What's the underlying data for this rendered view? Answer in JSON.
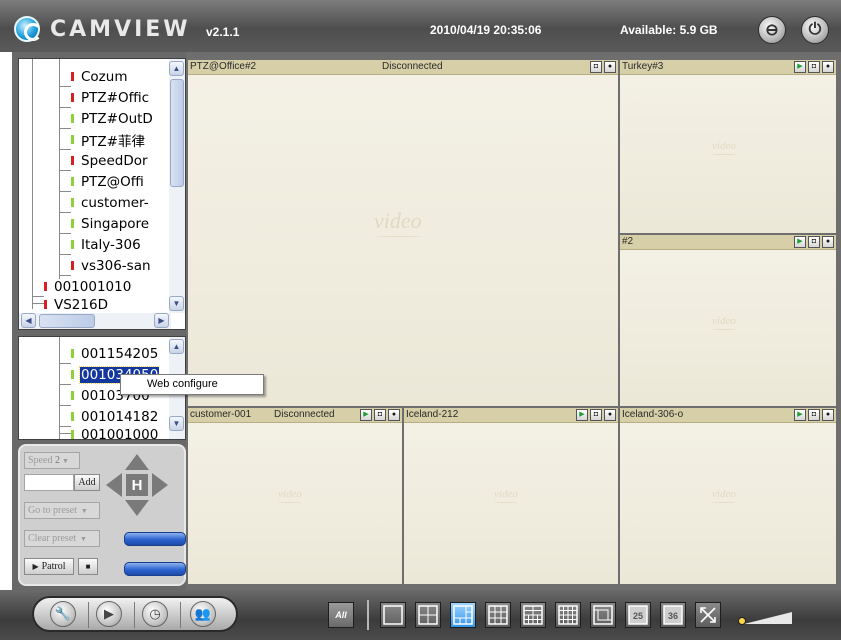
{
  "app": {
    "logo_text": "CAMVIEW",
    "version": "v2.1.1",
    "datetime": "2010/04/19 20:35:06",
    "available": "Available: 5.9 GB"
  },
  "colors": {
    "selection": "#14379e",
    "status_red": "#d72020",
    "status_green": "#8ed23a",
    "video_header": "#d7cfa8",
    "video_bg": "#f0ece0",
    "active_layout": "#3393e8"
  },
  "tree1": {
    "items": [
      {
        "label": "Cozum",
        "status": "red"
      },
      {
        "label": "PTZ#Offic",
        "status": "red"
      },
      {
        "label": "PTZ#OutD",
        "status": "green"
      },
      {
        "label": "PTZ#菲律",
        "status": "green"
      },
      {
        "label": "SpeedDor",
        "status": "red"
      },
      {
        "label": "PTZ@Offi",
        "status": "green"
      },
      {
        "label": "customer-",
        "status": "green"
      },
      {
        "label": "Singapore",
        "status": "green"
      },
      {
        "label": "Italy-306",
        "status": "green"
      },
      {
        "label": "vs306-san",
        "status": "red"
      },
      {
        "label": "001001010",
        "status": "red"
      },
      {
        "label": "VS216D",
        "status": "red"
      }
    ]
  },
  "tree2": {
    "items": [
      {
        "label": "001154205",
        "status": "green"
      },
      {
        "label": "001034050",
        "status": "green",
        "selected": true
      },
      {
        "label": "00103700",
        "status": "green"
      },
      {
        "label": "001014182",
        "status": "green"
      },
      {
        "label": "001001000",
        "status": "green"
      }
    ]
  },
  "context_menu": {
    "items": [
      "Web configure"
    ]
  },
  "ptz": {
    "speed_label": "Speed",
    "speed_value": "2",
    "add_label": "Add",
    "goto_preset": "Go to preset",
    "clear_preset": "Clear preset",
    "patrol_label": "Patrol",
    "home_label": "H"
  },
  "video": {
    "watermark": "video",
    "cells": [
      {
        "name": "PTZ@Office#2",
        "status": "Disconnected"
      },
      {
        "name": "Turkey#3",
        "status": ""
      },
      {
        "name": "#2",
        "status": ""
      },
      {
        "name": "customer-001",
        "status": "Disconnected"
      },
      {
        "name": "Iceland-212",
        "status": ""
      },
      {
        "name": "Iceland-306-o",
        "status": ""
      }
    ]
  },
  "bottombar": {
    "all_label": "All",
    "tools": [
      "settings-icon",
      "playback-icon",
      "schedule-icon",
      "users-icon"
    ],
    "layouts": [
      "1",
      "4",
      "6",
      "9",
      "10",
      "13",
      "16",
      "25",
      "36",
      "fullscreen"
    ],
    "active_layout": "6"
  }
}
